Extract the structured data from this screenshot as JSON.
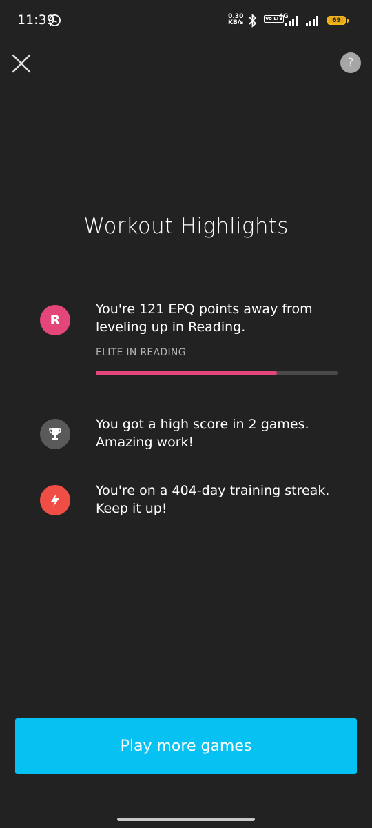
{
  "status_bar": {
    "time": "11:39",
    "net_speed_value": "0.30",
    "net_speed_unit": "KB/s",
    "volte": "Vo LTE",
    "network": "4G",
    "battery": "69"
  },
  "title": "Workout Highlights",
  "highlights": [
    {
      "icon": "R",
      "icon_color": "#e5467a",
      "text_line1": "You're 121 EPQ points away from",
      "text_line2": "leveling up in Reading.",
      "sub_label": "ELITE IN READING",
      "progress_fraction": 0.75
    },
    {
      "icon": "trophy-icon",
      "icon_color": "#5a5a5a",
      "text_line1": "You got a high score in 2 games.",
      "text_line2": "Amazing work!"
    },
    {
      "icon": "lightning-icon",
      "icon_color": "#f04e45",
      "text_line1": "You're on a 404-day training streak.",
      "text_line2": "Keep it up!"
    }
  ],
  "help_label": "?",
  "play_button_label": "Play more games",
  "colors": {
    "background": "#222222",
    "accent_button": "#06c2f2",
    "progress_fill": "#e5467a"
  }
}
